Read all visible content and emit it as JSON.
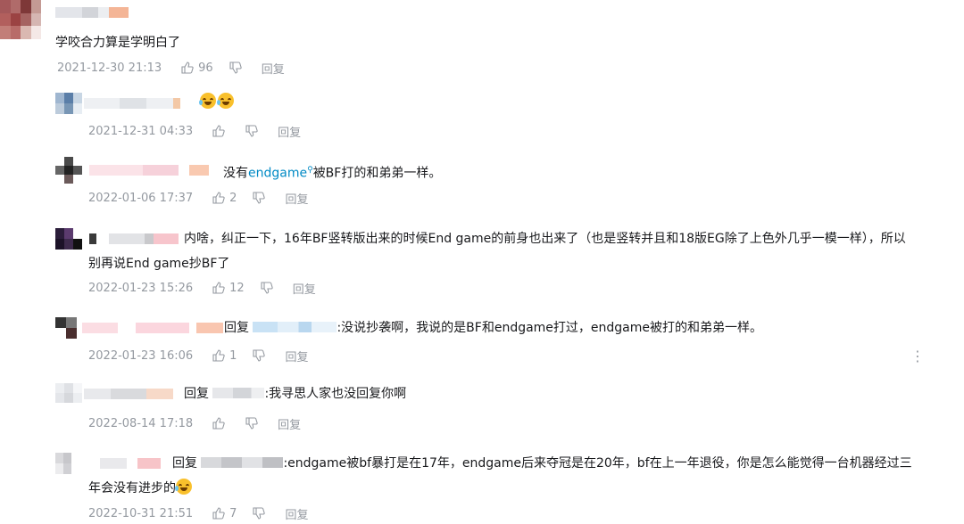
{
  "comments": [
    {
      "text": "学咬合力算是学明白了",
      "time": "2021-12-30 21:13",
      "likes": "96",
      "reply_label": "回复"
    }
  ],
  "replies": [
    {
      "emoji": "laughing-tears-emoji",
      "time": "2021-12-31 04:33",
      "likes": "",
      "reply_label": "回复"
    },
    {
      "prefix": "没有",
      "keyword": "endgame",
      "suffix": "被BF打的和弟弟一样。",
      "time": "2022-01-06 17:37",
      "likes": "2",
      "reply_label": "回复"
    },
    {
      "line1": "内啥，纠正一下，16年BF竖转版出来的时候End game的前身也出来了（也是竖转并且和18版EG除了上色外几乎一模一样），所以",
      "line2": "别再说End game抄BF了",
      "time": "2022-01-23 15:26",
      "likes": "12",
      "reply_label": "回复"
    },
    {
      "reply_word": "回复",
      "text": ":没说抄袭啊，我说的是BF和endgame打过，endgame被打的和弟弟一样。",
      "time": "2022-01-23 16:06",
      "likes": "1",
      "reply_label": "回复",
      "more": "⋮"
    },
    {
      "reply_word": "回复",
      "text": ":我寻思人家也没回复你啊",
      "time": "2022-08-14 17:18",
      "likes": "",
      "reply_label": "回复"
    },
    {
      "reply_word": "回复",
      "line1": ":endgame被bf暴打是在17年，endgame后来夺冠是在20年，bf在上一年退役，你是怎么能觉得一台机器经过三",
      "line2": "年会没有进步的",
      "emoji": "sweat-smile-emoji",
      "time": "2022-10-31 21:51",
      "likes": "7",
      "reply_label": "回复"
    }
  ]
}
